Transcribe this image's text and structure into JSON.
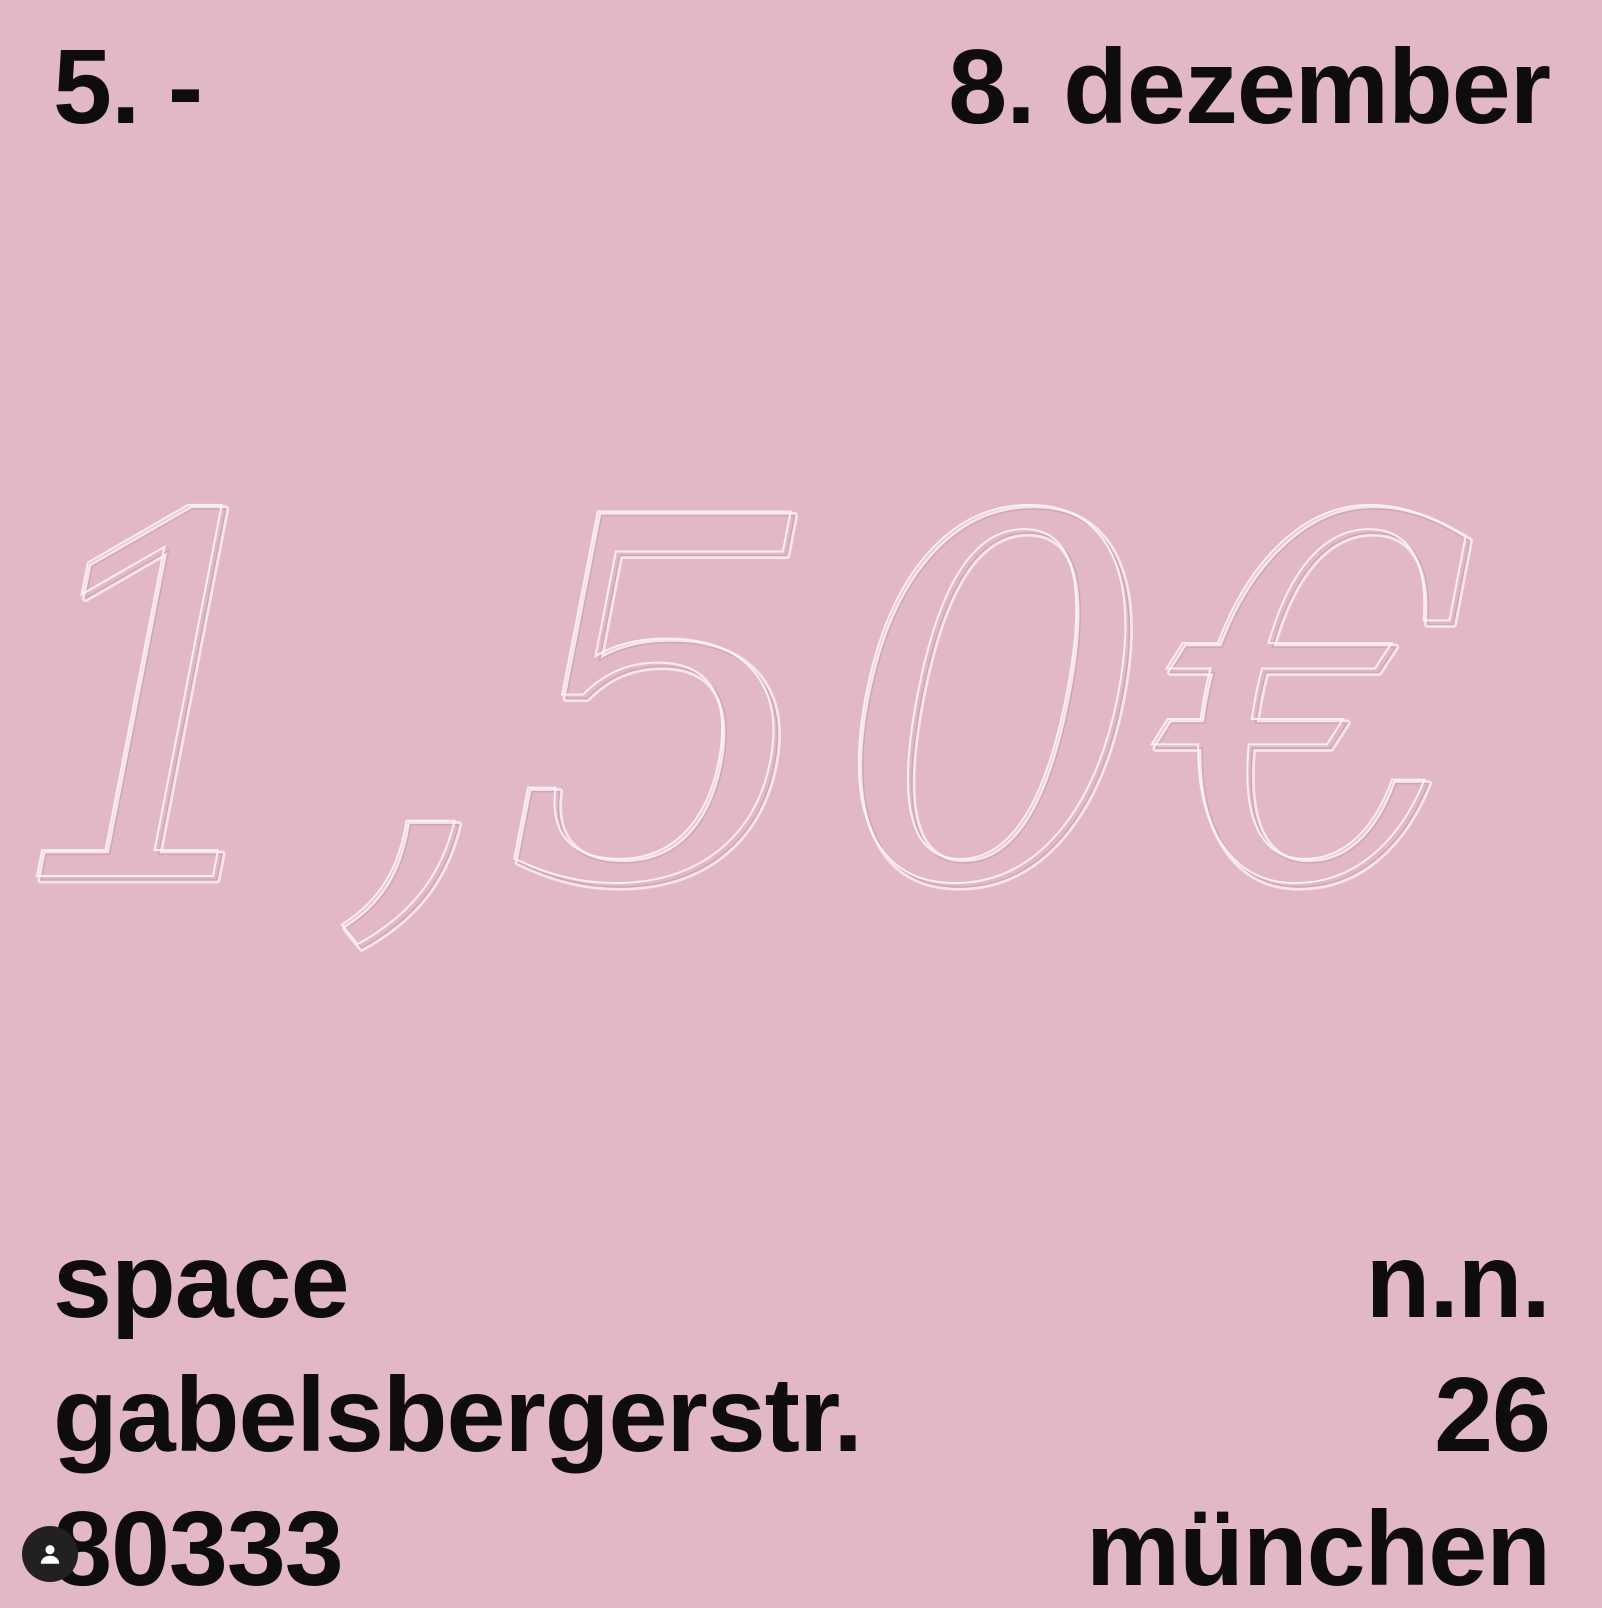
{
  "dates": {
    "start": "5. -",
    "end": "8. dezember"
  },
  "price": {
    "text": "1,50€"
  },
  "venue": {
    "name": "space",
    "street": "gabelsbergerstr.",
    "zip": "80333",
    "suffix": "n.n.",
    "number": "26",
    "city": "münchen"
  },
  "icons": {
    "avatar": "user-icon"
  },
  "colors": {
    "background": "#e2b8c4",
    "text": "#0f0c0d",
    "price_outline": "#f6e6ec"
  }
}
